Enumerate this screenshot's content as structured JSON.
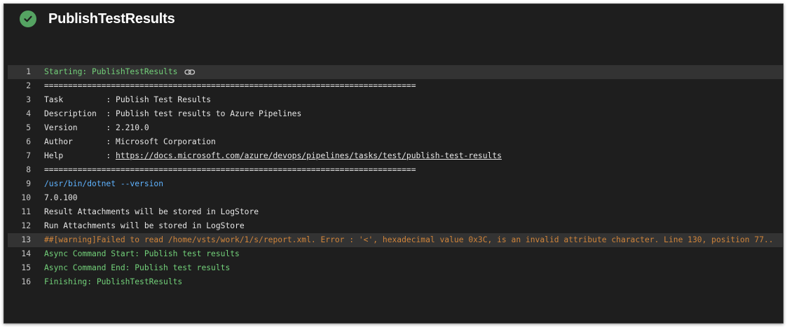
{
  "header": {
    "title": "PublishTestResults",
    "status": "succeeded",
    "status_icon": "check-circle-icon",
    "status_color": "#55a362"
  },
  "colors": {
    "background": "#1e1e1e",
    "section": "#73d17a",
    "command": "#5fb3ff",
    "warning": "#d0843a"
  },
  "log": {
    "lines": [
      {
        "num": "1",
        "text": "Starting: PublishTestResults"
      },
      {
        "num": "2",
        "text": "=============================================================================="
      },
      {
        "num": "3",
        "text": "Task         : Publish Test Results"
      },
      {
        "num": "4",
        "text": "Description  : Publish test results to Azure Pipelines"
      },
      {
        "num": "5",
        "text": "Version      : 2.210.0"
      },
      {
        "num": "6",
        "text": "Author       : Microsoft Corporation"
      },
      {
        "num": "7",
        "text": "Help         : ",
        "link": "https://docs.microsoft.com/azure/devops/pipelines/tasks/test/publish-test-results"
      },
      {
        "num": "8",
        "text": "=============================================================================="
      },
      {
        "num": "9",
        "text": "/usr/bin/dotnet --version"
      },
      {
        "num": "10",
        "text": "7.0.100"
      },
      {
        "num": "11",
        "text": "Result Attachments will be stored in LogStore"
      },
      {
        "num": "12",
        "text": "Run Attachments will be stored in LogStore"
      },
      {
        "num": "13",
        "text": "##[warning]Failed to read /home/vsts/work/1/s/report.xml. Error : '<', hexadecimal value 0x3C, is an invalid attribute character. Line 130, position 77.."
      },
      {
        "num": "14",
        "text": "Async Command Start: Publish test results"
      },
      {
        "num": "15",
        "text": "Async Command End: Publish test results"
      },
      {
        "num": "16",
        "text": "Finishing: PublishTestResults"
      }
    ]
  }
}
